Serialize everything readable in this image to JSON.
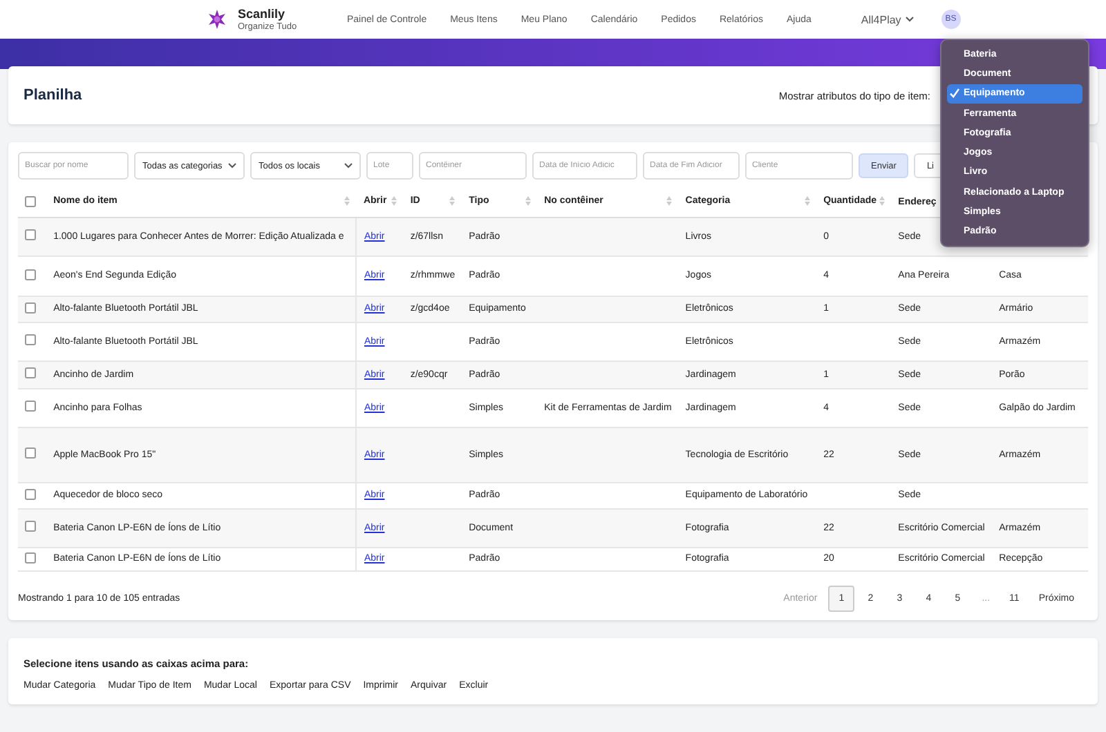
{
  "brand": {
    "name": "Scanlily",
    "tagline": "Organize Tudo"
  },
  "nav": [
    "Painel de Controle",
    "Meus Itens",
    "Meu Plano",
    "Calendário",
    "Pedidos",
    "Relatórios",
    "Ajuda"
  ],
  "account": {
    "name": "All4Play",
    "avatar": "BS"
  },
  "page": {
    "title": "Planilha",
    "attr_label": "Mostrar atributos do tipo de item:"
  },
  "type_menu": [
    {
      "label": "Bateria",
      "selected": false
    },
    {
      "label": "Document",
      "selected": false
    },
    {
      "label": "Equipamento",
      "selected": true
    },
    {
      "label": "Ferramenta",
      "selected": false
    },
    {
      "label": "Fotografia",
      "selected": false
    },
    {
      "label": "Jogos",
      "selected": false
    },
    {
      "label": "Livro",
      "selected": false
    },
    {
      "label": "Relacionado a Laptop",
      "selected": false
    },
    {
      "label": "Simples",
      "selected": false
    },
    {
      "label": "Padrão",
      "selected": false
    }
  ],
  "filters": [
    {
      "kind": "input",
      "placeholder": "Buscar por nome"
    },
    {
      "kind": "select",
      "value": "Todas as categorias"
    },
    {
      "kind": "select",
      "value": "Todos os locais"
    },
    {
      "kind": "input",
      "placeholder": "Lote"
    },
    {
      "kind": "input",
      "placeholder": "Contêiner"
    },
    {
      "kind": "input",
      "placeholder": "Data de Início Adicic"
    },
    {
      "kind": "input",
      "placeholder": "Data de Fim Adicior"
    },
    {
      "kind": "input",
      "placeholder": "Cliente"
    },
    {
      "kind": "button",
      "label": "Enviar"
    },
    {
      "kind": "ghost",
      "label": "Li"
    }
  ],
  "table": {
    "select_all_checked": false,
    "columns": [
      "Nome do item",
      "Abrir",
      "ID",
      "Tipo",
      "No contêiner",
      "Categoria",
      "Quantidade",
      "Endereç"
    ],
    "rows": [
      {
        "checked": false,
        "name": "1.000 Lugares para Conhecer Antes de Morrer: Edição Atualizada e",
        "open": "Abrir",
        "id": "z/67llsn",
        "type": "Padrão",
        "container": "",
        "category": "Livros",
        "quantity": "0",
        "address": "Sede",
        "column_9": ""
      },
      {
        "checked": false,
        "name": "Aeon's End Segunda Edição",
        "open": "Abrir",
        "id": "z/rhmmwe",
        "type": "Padrão",
        "container": "",
        "category": "Jogos",
        "quantity": "4",
        "address": "Ana Pereira",
        "column_9": "Casa"
      },
      {
        "checked": false,
        "name": "Alto-falante Bluetooth Portátil JBL",
        "open": "Abrir",
        "id": "z/gcd4oe",
        "type": "Equipamento",
        "container": "",
        "category": "Eletrônicos",
        "quantity": "1",
        "address": "Sede",
        "column_9": "Armário"
      },
      {
        "checked": false,
        "name": "Alto-falante Bluetooth Portátil JBL",
        "open": "Abrir",
        "id": "",
        "type": "Padrão",
        "container": "",
        "category": "Eletrônicos",
        "quantity": "",
        "address": "Sede",
        "column_9": "Armazém"
      },
      {
        "checked": false,
        "name": "Ancinho de Jardim",
        "open": "Abrir",
        "id": "z/e90cqr",
        "type": "Padrão",
        "container": "",
        "category": "Jardinagem",
        "quantity": "1",
        "address": "Sede",
        "column_9": "Porão"
      },
      {
        "checked": false,
        "name": "Ancinho para Folhas",
        "open": "Abrir",
        "id": "",
        "type": "Simples",
        "container": "Kit de Ferramentas de Jardim",
        "category": "Jardinagem",
        "quantity": "4",
        "address": "Sede",
        "column_9": "Galpão do Jardim"
      },
      {
        "checked": false,
        "name": "Apple MacBook Pro 15\"",
        "open": "Abrir",
        "id": "",
        "type": "Simples",
        "container": "",
        "category": "Tecnologia de Escritório",
        "quantity": "22",
        "address": "Sede",
        "column_9": "Armazém"
      },
      {
        "checked": false,
        "name": "Aquecedor de bloco seco",
        "open": "Abrir",
        "id": "",
        "type": "Padrão",
        "container": "",
        "category": "Equipamento de Laboratório",
        "quantity": "",
        "address": "Sede",
        "column_9": ""
      },
      {
        "checked": false,
        "name": "Bateria Canon LP-E6N de Íons de Lítio",
        "open": "Abrir",
        "id": "",
        "type": "Document",
        "container": "",
        "category": "Fotografia",
        "quantity": "22",
        "address": "Escritório Comercial",
        "column_9": "Armazém"
      },
      {
        "checked": false,
        "name": "Bateria Canon LP-E6N de Íons de Lítio",
        "open": "Abrir",
        "id": "",
        "type": "Padrão",
        "container": "",
        "category": "Fotografia",
        "quantity": "20",
        "address": "Escritório Comercial",
        "column_9": "Recepção"
      }
    ]
  },
  "summary": "Mostrando 1 para 10 de 105 entradas",
  "pagination": [
    {
      "label": "Anterior",
      "kind": "nav",
      "disabled": true
    },
    {
      "label": "1",
      "kind": "page",
      "selected": true
    },
    {
      "label": "2",
      "kind": "page",
      "selected": false
    },
    {
      "label": "3",
      "kind": "page",
      "selected": false
    },
    {
      "label": "4",
      "kind": "page",
      "selected": false
    },
    {
      "label": "5",
      "kind": "page",
      "selected": false
    },
    {
      "label": "...",
      "kind": "gap"
    },
    {
      "label": "11",
      "kind": "page",
      "selected": false
    },
    {
      "label": "Próximo",
      "kind": "nav",
      "disabled": false
    }
  ],
  "bulk": {
    "title": "Selecione itens usando as caixas acima para:",
    "actions": [
      "Mudar Categoria",
      "Mudar Tipo de Item",
      "Mudar Local",
      "Exportar para CSV",
      "Imprimir",
      "Arquivar",
      "Excluir"
    ]
  }
}
